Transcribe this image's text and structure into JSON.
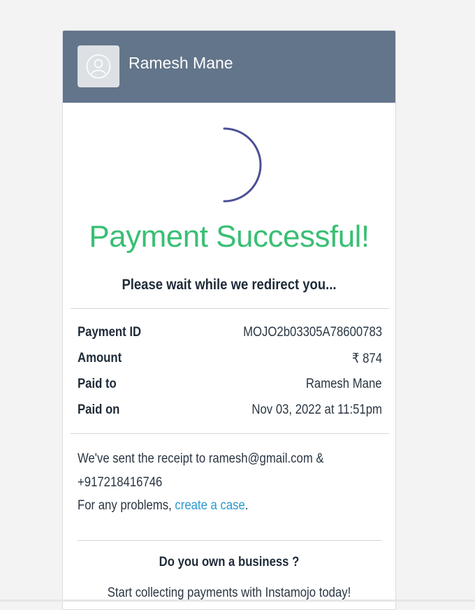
{
  "header": {
    "merchant_name": "Ramesh Mane",
    "avatar_icon": "user-avatar-icon"
  },
  "status": {
    "spinner_icon": "loading-spinner-icon",
    "title": "Payment Successful!",
    "message": "Please wait while we redirect you..."
  },
  "details": [
    {
      "label": "Payment ID",
      "value": "MOJO2b03305A78600783"
    },
    {
      "label": "Amount",
      "value": "₹ 874"
    },
    {
      "label": "Paid to",
      "value": "Ramesh Mane"
    },
    {
      "label": "Paid on",
      "value": "Nov 03, 2022 at 11:51pm"
    }
  ],
  "receipt": {
    "line1": "We've sent the receipt to ramesh@gmail.com &",
    "line2": "+917218416746",
    "problems_prefix": "For any problems, ",
    "link_text": "create a case",
    "problems_suffix": "."
  },
  "business": {
    "title": "Do you own a business ?",
    "subtitle": "Start collecting payments with Instamojo today!"
  },
  "colors": {
    "header_bg": "#63758a",
    "success": "#39bf74",
    "link": "#2a98d4",
    "spinner": "#4d4f96"
  }
}
